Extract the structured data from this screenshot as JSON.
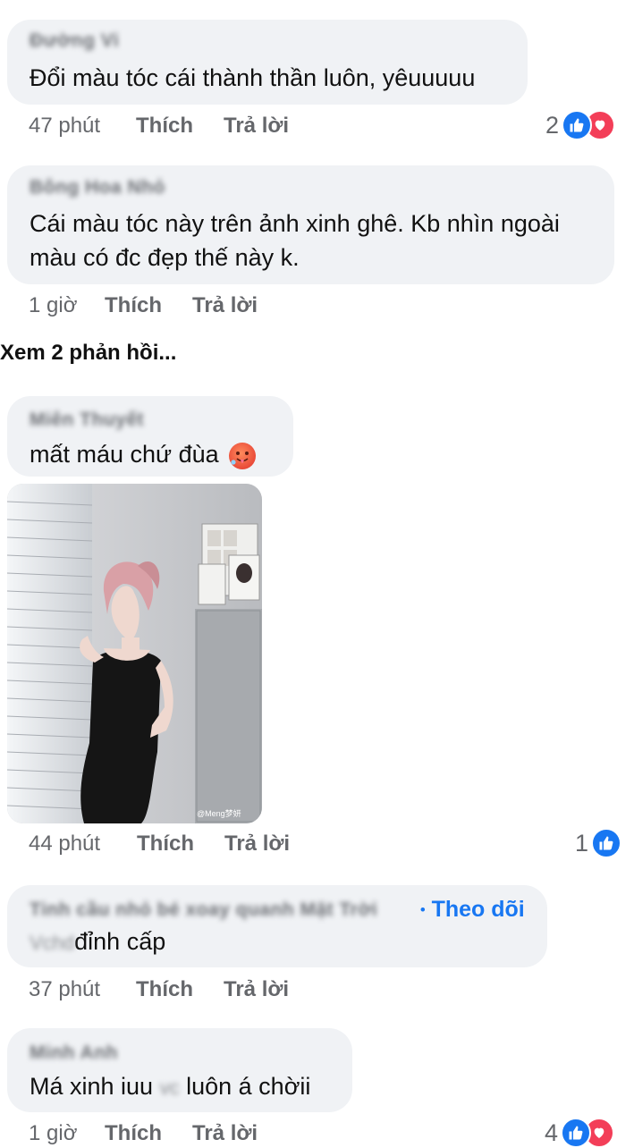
{
  "comments": [
    {
      "author": "Đường Vi",
      "text": "Đổi màu tóc cái thành thần luôn, yêuuuuu",
      "time": "47 phút",
      "like_label": "Thích",
      "reply_label": "Trả lời",
      "reaction_count": "2"
    },
    {
      "author": "Bông Hoa Nhỏ",
      "text_line1": "Cái màu tóc này trên ảnh xinh ghê. Kb nhìn ngoài",
      "text_line2": "màu có đc đẹp thế này k.",
      "time": "1 giờ",
      "like_label": "Thích",
      "reply_label": "Trả lời"
    },
    {
      "author": "Miên Thuyết",
      "text": "mất máu chứ đùa",
      "emoji": "hot-face",
      "image_watermark": "@Meng梦妍",
      "time": "44 phút",
      "like_label": "Thích",
      "reply_label": "Trả lời",
      "reaction_count": "1"
    },
    {
      "author": "Tinh cầu nhỏ bé xoay quanh Mặt Trời",
      "follow_label": "Theo dõi",
      "text_blurred_prefix": "Vchd",
      "text": "đỉnh cấp",
      "time": "37 phút",
      "like_label": "Thích",
      "reply_label": "Trả lời"
    },
    {
      "author": "Minh Anh",
      "text_part1": "Má xinh iuu",
      "text_blurred_middle": "vc",
      "text_part2": "luôn á chờii",
      "time": "1 giờ",
      "like_label": "Thích",
      "reply_label": "Trả lời",
      "reaction_count": "4"
    }
  ],
  "view_replies_label": "Xem 2 phản hồi...",
  "colors": {
    "bubble": "#f0f2f5",
    "like_blue": "#1877f2",
    "love_red": "#f33e58",
    "meta_gray": "#65676b"
  }
}
